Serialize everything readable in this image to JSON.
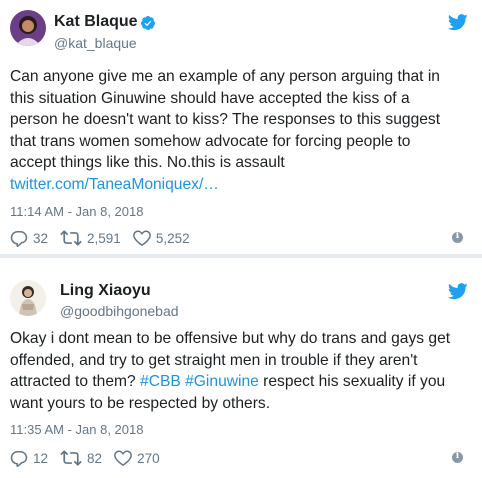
{
  "tweets": [
    {
      "name": "Kat Blaque",
      "handle": "@kat_blaque",
      "verified": true,
      "text_lines": [
        "Can anyone give me an example of any person arguing that in",
        "this situation Ginuwine should have accepted the kiss of a",
        "person he doesn't want to kiss? The responses to this suggest",
        "that trans women somehow advocate for forcing people to",
        "accept things like this. No.this is assault"
      ],
      "link": "twitter.com/TaneaMoniquex/…",
      "timestamp": "11:14 AM - Jan 8, 2018",
      "replies": "32",
      "retweets": "2,591",
      "likes": "5,252"
    },
    {
      "name": "Ling Xiaoyu",
      "handle": "@goodbihgonebad",
      "verified": false,
      "text_lines": [
        "Okay i dont mean to be offensive but why do trans and gays get",
        "offended, and try to get straight men in trouble if they aren't",
        "attracted to them?",
        "respect his sexuality if you",
        "want yours to be respected by others."
      ],
      "hashtags": [
        "#CBB",
        "#Ginuwine"
      ],
      "timestamp": "11:35 AM - Jan 8, 2018",
      "replies": "12",
      "retweets": "82",
      "likes": "270"
    }
  ],
  "icons": {
    "verified": "verified-badge-icon",
    "bird": "twitter-bird-icon",
    "reply": "reply-icon",
    "retweet": "retweet-icon",
    "like": "heart-icon",
    "info": "info-icon"
  },
  "colors": {
    "brand_blue": "#1da1f2",
    "link_blue": "#1b95e0",
    "text": "#1c2022",
    "muted": "#657786",
    "divider": "#e6ecf0"
  }
}
